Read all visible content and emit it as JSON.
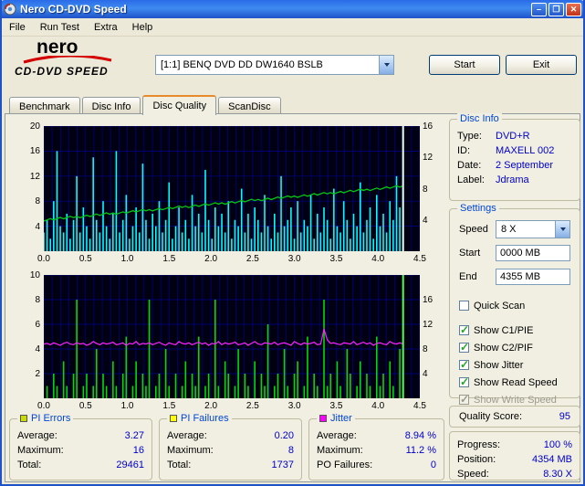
{
  "window": {
    "title": "Nero CD-DVD Speed",
    "minimize": "–",
    "maximize": "❐",
    "close": "✕"
  },
  "menu": {
    "items": [
      "File",
      "Run Test",
      "Extra",
      "Help"
    ]
  },
  "header": {
    "logo_line1": "nero",
    "logo_line2": "CD-DVD SPEED",
    "drive": "[1:1]   BENQ DVD DD DW1640 BSLB",
    "start_button": "Start",
    "exit_button": "Exit"
  },
  "tabs": [
    {
      "label": "Benchmark"
    },
    {
      "label": "Disc Info"
    },
    {
      "label": "Disc Quality"
    },
    {
      "label": "ScanDisc"
    }
  ],
  "active_tab": 2,
  "disc_info": {
    "title": "Disc Info",
    "rows": [
      {
        "label": "Type:",
        "value": "DVD+R"
      },
      {
        "label": "ID:",
        "value": "MAXELL 002"
      },
      {
        "label": "Date:",
        "value": "2 September"
      },
      {
        "label": "Label:",
        "value": "Jdrama"
      }
    ]
  },
  "settings": {
    "title": "Settings",
    "speed_label": "Speed",
    "speed_value": "8 X",
    "start_label": "Start",
    "start_value": "0000 MB",
    "end_label": "End",
    "end_value": "4355 MB",
    "checkboxes": [
      {
        "label": "Quick Scan",
        "checked": false,
        "disabled": false
      },
      {
        "label": "Show C1/PIE",
        "checked": true,
        "disabled": false
      },
      {
        "label": "Show C2/PIF",
        "checked": true,
        "disabled": false
      },
      {
        "label": "Show Jitter",
        "checked": true,
        "disabled": false
      },
      {
        "label": "Show Read Speed",
        "checked": true,
        "disabled": false
      },
      {
        "label": "Show Write Speed",
        "checked": true,
        "disabled": true
      }
    ]
  },
  "quality": {
    "label": "Quality Score:",
    "value": "95"
  },
  "progress_box": {
    "rows": [
      {
        "label": "Progress:",
        "value": "100 %"
      },
      {
        "label": "Position:",
        "value": "4354 MB"
      },
      {
        "label": "Speed:",
        "value": "8.30 X"
      }
    ]
  },
  "legend_boxes": [
    {
      "title": "PI Errors",
      "color": "#C8DC00",
      "rows": [
        {
          "label": "Average:",
          "value": "3.27"
        },
        {
          "label": "Maximum:",
          "value": "16"
        },
        {
          "label": "Total:",
          "value": "29461"
        }
      ]
    },
    {
      "title": "PI Failures",
      "color": "#FFFF00",
      "rows": [
        {
          "label": "Average:",
          "value": "0.20"
        },
        {
          "label": "Maximum:",
          "value": "8"
        },
        {
          "label": "Total:",
          "value": "1737"
        }
      ]
    },
    {
      "title": "Jitter",
      "color": "#FF00FF",
      "rows": [
        {
          "label": "Average:",
          "value": "8.94 %"
        },
        {
          "label": "Maximum:",
          "value": "11.2 %"
        },
        {
          "label": "PO Failures:",
          "value": "0"
        }
      ]
    }
  ],
  "chart_data": [
    {
      "type": "bar",
      "name": "pi-errors-graph",
      "bg": "#000012",
      "grid": "#000090",
      "bar_color": "#00FFFF",
      "ylim": [
        0,
        20
      ],
      "yticks": [
        20,
        16,
        12,
        8,
        4
      ],
      "right_ylim": [
        0,
        16
      ],
      "right_ticks": [
        16,
        12,
        8,
        4
      ],
      "xlim": [
        0,
        4.5
      ],
      "x_end": 4.3,
      "xticks": [
        "0.0",
        "0.5",
        "1.0",
        "1.5",
        "2.0",
        "2.5",
        "3.0",
        "3.5",
        "4.0",
        "4.5"
      ],
      "bars": [
        3,
        5,
        2,
        8,
        16,
        4,
        3,
        6,
        2,
        5,
        12,
        3,
        7,
        4,
        2,
        15,
        5,
        3,
        8,
        4,
        2,
        6,
        16,
        3,
        5,
        9,
        2,
        4,
        7,
        3,
        14,
        5,
        2,
        6,
        4,
        8,
        3,
        5,
        11,
        2,
        4,
        7,
        3,
        5,
        2,
        9,
        4,
        6,
        3,
        13,
        5,
        2,
        7,
        4,
        6,
        3,
        8,
        2,
        5,
        4,
        10,
        3,
        6,
        2,
        7,
        5,
        3,
        9,
        4,
        2,
        6,
        3,
        12,
        4,
        5,
        7,
        2,
        8,
        3,
        5,
        4,
        9,
        2,
        6,
        3,
        7,
        5,
        2,
        10,
        4,
        3,
        8,
        5,
        2,
        6,
        4,
        11,
        3,
        5,
        7,
        2,
        9,
        4,
        6,
        3,
        8,
        5,
        12,
        7,
        20
      ],
      "line": {
        "name": "read-speed",
        "color": "#00C814",
        "axis_max": 16,
        "start": 4.0,
        "end": 8.3
      },
      "end_line": {
        "color": "#E8FFFF"
      }
    },
    {
      "type": "bar",
      "name": "pi-failures-jitter-graph",
      "bg": "#000012",
      "grid": "#000090",
      "bar_color": "#00DC00",
      "ylim": [
        0,
        10
      ],
      "yticks": [
        10,
        8,
        6,
        4,
        2
      ],
      "right_ylim": [
        0,
        20
      ],
      "right_ticks": [
        16,
        12,
        8,
        4
      ],
      "xlim": [
        0,
        4.5
      ],
      "x_end": 4.3,
      "xticks": [
        "0.0",
        "0.5",
        "1.0",
        "1.5",
        "2.0",
        "2.5",
        "3.0",
        "3.5",
        "4.0",
        "4.5"
      ],
      "bars": [
        0,
        1,
        0,
        2,
        1,
        0,
        3,
        1,
        0,
        2,
        8,
        0,
        1,
        2,
        0,
        1,
        4,
        0,
        2,
        1,
        0,
        3,
        1,
        0,
        2,
        5,
        0,
        1,
        3,
        0,
        2,
        1,
        8,
        0,
        1,
        2,
        0,
        4,
        1,
        0,
        2,
        0,
        1,
        3,
        0,
        2,
        1,
        5,
        0,
        1,
        2,
        0,
        8,
        1,
        0,
        3,
        2,
        0,
        1,
        4,
        0,
        2,
        1,
        0,
        3,
        0,
        2,
        1,
        6,
        0,
        1,
        2,
        0,
        4,
        1,
        0,
        2,
        3,
        0,
        1,
        5,
        0,
        2,
        1,
        0,
        8,
        1,
        2,
        0,
        3,
        1,
        0,
        4,
        2,
        0,
        1,
        3,
        0,
        2,
        1,
        0,
        5,
        1,
        2,
        0,
        3,
        1,
        0,
        4,
        10
      ],
      "jitter": {
        "name": "jitter",
        "color": "#FF22FF",
        "axis_max": 20,
        "values": [
          8.8,
          8.9,
          8.7,
          9.0,
          8.8,
          8.6,
          8.9,
          9.1,
          8.8,
          8.7,
          9.0,
          8.8,
          8.9,
          8.6,
          8.8,
          9.2,
          8.9,
          8.7,
          9.0,
          8.8,
          8.9,
          9.1,
          8.7,
          8.8,
          9.0,
          8.6,
          8.9,
          8.8,
          9.2,
          8.7,
          8.9,
          8.8,
          9.0,
          8.7,
          8.9,
          9.1,
          8.8,
          8.6,
          9.0,
          8.8,
          8.7,
          9.2,
          8.9,
          8.8,
          9.0,
          8.7,
          8.9,
          9.1,
          8.8,
          9.0,
          8.6,
          8.9,
          8.8,
          9.2,
          8.7,
          9.0,
          8.8,
          8.9,
          9.1,
          8.7,
          8.8,
          9.0,
          8.6,
          8.9,
          9.2,
          8.8,
          8.7,
          9.0,
          8.9,
          8.8,
          9.1,
          8.7,
          8.9,
          9.0,
          8.8,
          8.6,
          9.2,
          8.9,
          8.7,
          9.0,
          8.8,
          8.9,
          9.1,
          8.7,
          8.8,
          11.2,
          9.5,
          8.9,
          9.0,
          8.8,
          8.7,
          9.0,
          8.9,
          8.8,
          9.2,
          8.7,
          8.9,
          9.1,
          8.8,
          9.0,
          8.6,
          8.9,
          9.0,
          8.8,
          8.7,
          9.2,
          8.9,
          8.8,
          9.0,
          8.8
        ]
      },
      "end_line": {
        "color": "#50FF50"
      }
    }
  ]
}
